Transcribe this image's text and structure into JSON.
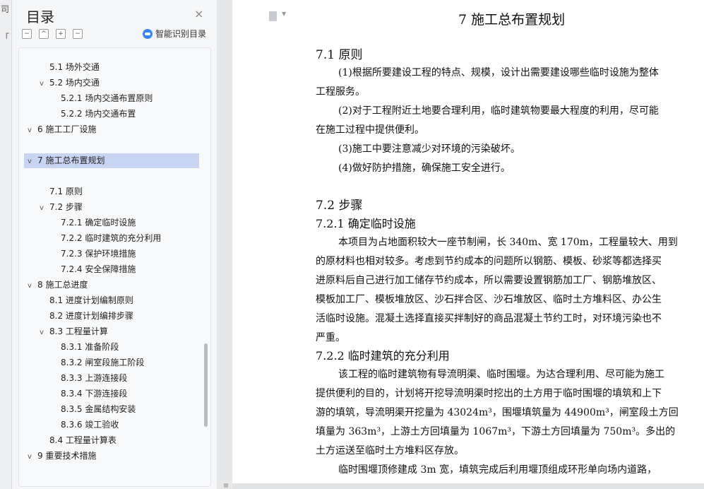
{
  "left_strip": {
    "glyph1": "司",
    "glyph2": "「"
  },
  "nav": {
    "title": "目录",
    "close": "×",
    "tools": {
      "collapse": "−",
      "expand_up": "^",
      "add": "+",
      "remove": "−"
    },
    "smart_label": "智能识别目录",
    "items": [
      {
        "label": "5.1 场外交通",
        "chev": ""
      },
      {
        "label": "5.2 场内交通",
        "chev": "v"
      },
      {
        "label": "5.2.1 场内交通布置原则",
        "chev": ""
      },
      {
        "label": "5.2.2 场内交通布置",
        "chev": ""
      },
      {
        "label": "6   施工工厂设施",
        "chev": "v"
      },
      {
        "label": "7   施工总布置规划",
        "chev": "v"
      },
      {
        "label": "7.1 原则",
        "chev": ""
      },
      {
        "label": "7.2 步骤",
        "chev": "v"
      },
      {
        "label": "7.2.1 确定临时设施",
        "chev": ""
      },
      {
        "label": "7.2.2 临时建筑的充分利用",
        "chev": ""
      },
      {
        "label": "7.2.3 保护环境措施",
        "chev": ""
      },
      {
        "label": "7.2.4 安全保障措施",
        "chev": ""
      },
      {
        "label": "8   施工总进度",
        "chev": "v"
      },
      {
        "label": "8.1 进度计划编制原则",
        "chev": ""
      },
      {
        "label": "8.2 进度计划编排步骤",
        "chev": ""
      },
      {
        "label": "8.3 工程量计算",
        "chev": "v"
      },
      {
        "label": "8.3.1 准备阶段",
        "chev": ""
      },
      {
        "label": "8.3.2 闸室段施工阶段",
        "chev": ""
      },
      {
        "label": "8.3.3 上游连接段",
        "chev": ""
      },
      {
        "label": "8.3.4 下游连接段",
        "chev": ""
      },
      {
        "label": "8.3.5 金属结构安装",
        "chev": ""
      },
      {
        "label": "8.3.6 竣工验收",
        "chev": ""
      },
      {
        "label": "8.4 工程量计算表",
        "chev": ""
      },
      {
        "label": "9   重要技术措施",
        "chev": "v"
      }
    ]
  },
  "doc": {
    "chapter_title": "7   施工总布置规划",
    "s71_title": "7.1 原则",
    "s71_lines": [
      "(1)根据所要建设工程的特点、规模，设计出需要建设哪些临时设施为整体",
      "工程服务。",
      "(2)对于工程附近土地要合理利用，临时建筑物要最大程度的利用，尽可能",
      "在施工过程中提供便利。",
      "(3)施工中要注意减少对环境的污染破坏。",
      "(4)做好防护措施，确保施工安全进行。"
    ],
    "s72_title": "7.2 步骤",
    "s721_title": "7.2.1 确定临时设施",
    "s721_lines": [
      "本项目为占地面积较大一座节制闸，长 340m、宽 170m，工程量较大、用到",
      "的原材料也相对较多。考虑到节约成本的问题所以钢筋、模板、砂浆等都选择买",
      "进原料后自己进行加工储存节约成本，所以需要设置钢筋加工厂、钢筋堆放区、",
      "模板加工厂、模板堆放区、沙石拌合区、沙石堆放区、临时土方堆料区、办公生",
      "活临时设施。混凝土选择直接买拌制好的商品混凝土节约工时，对环境污染也不",
      "严重。"
    ],
    "s722_title": "7.2.2 临时建筑的充分利用",
    "s722_lines": [
      "该工程的临时建筑物有导流明渠、临时围堰。为达合理利用、尽可能为施工",
      "提供便利的目的，计划将开挖导流明渠时挖出的土方用于临时围堰的填筑和上下",
      "游的填筑，导流明渠开挖量为 43024m³，围堰填筑量为 44900m³，闸室段土方回",
      "填量为 363m³，上游土方回填量为 1067m³，下游土方回填量为 750m³。多出的",
      "土方运送至临时土方堆料区存放。",
      "临时围堰顶修建成 3m 宽，填筑完成后利用堰顶组成环形单向场内道路，"
    ]
  }
}
